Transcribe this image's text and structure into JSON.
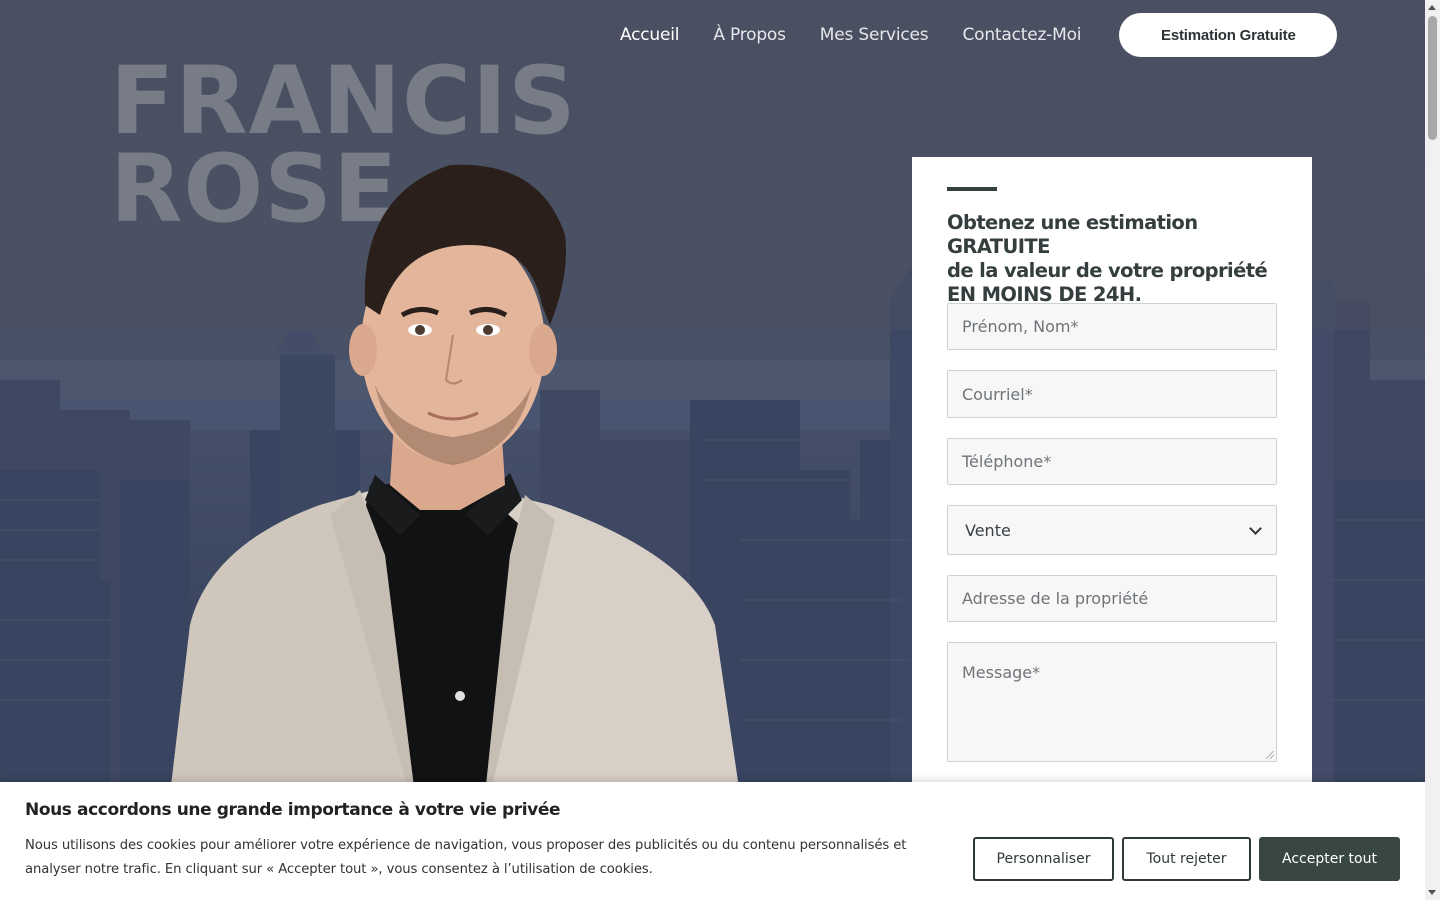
{
  "nav": {
    "items": [
      {
        "label": "Accueil"
      },
      {
        "label": "À Propos"
      },
      {
        "label": "Mes Services"
      },
      {
        "label": "Contactez-Moi"
      }
    ],
    "cta_label": "Estimation Gratuite"
  },
  "hero": {
    "name_line1": "FRANCIS",
    "name_line2": "ROSE"
  },
  "form": {
    "heading_line1": "Obtenez une estimation GRATUITE",
    "heading_line2": "de la valeur de votre propriété",
    "heading_line3": "EN MOINS DE 24H.",
    "name_placeholder": "Prénom, Nom*",
    "email_placeholder": "Courriel*",
    "phone_placeholder": "Téléphone*",
    "type_selected": "Vente",
    "address_placeholder": "Adresse de la propriété",
    "message_placeholder": "Message*"
  },
  "cookie": {
    "title": "Nous accordons une grande importance à votre vie privée",
    "text": "Nous utilisons des cookies pour améliorer votre expérience de navigation, vous proposer des publicités ou du contenu personnalisés et analyser notre trafic. En cliquant sur « Accepter tout », vous consentez à l’utilisation de cookies.",
    "customize_label": "Personnaliser",
    "reject_label": "Tout rejeter",
    "accept_label": "Accepter tout"
  },
  "colors": {
    "accent_dark_green": "#38473f",
    "heading_text": "#353e3e",
    "overlay_blue": "#3b4458"
  }
}
